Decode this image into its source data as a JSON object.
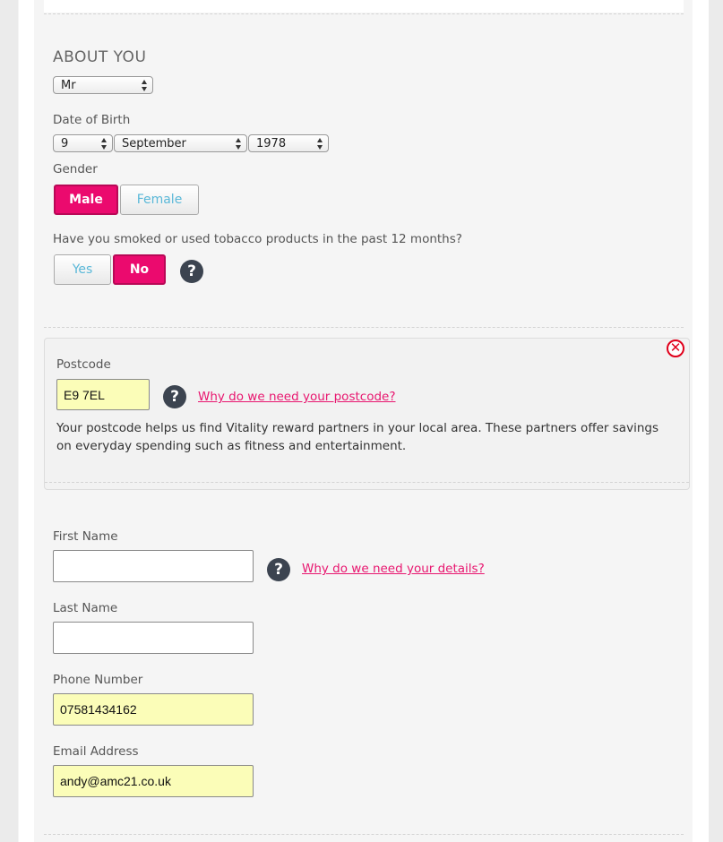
{
  "about": {
    "heading": "ABOUT YOU",
    "title_select": "Mr",
    "dob_label": "Date of Birth",
    "dob_day": "9",
    "dob_month": "September",
    "dob_year": "1978",
    "gender_label": "Gender",
    "gender_male": "Male",
    "gender_female": "Female",
    "gender_selected": "Male",
    "smoke_question": "Have you smoked or used tobacco products in the past 12 months?",
    "smoke_yes": "Yes",
    "smoke_no": "No",
    "smoke_selected": "No"
  },
  "postcode": {
    "label": "Postcode",
    "value": "E9 7EL",
    "help_link": "Why do we need your postcode?",
    "info": "Your postcode helps us find Vitality reward partners in your local area. These partners offer savings on everyday spending such as fitness and entertainment."
  },
  "details": {
    "first_name_label": "First Name",
    "first_name_value": "",
    "help_link": "Why do we need your details?",
    "last_name_label": "Last Name",
    "last_name_value": "",
    "phone_label": "Phone Number",
    "phone_value": "07581434162",
    "email_label": "Email Address",
    "email_value": "andy@amc21.co.uk"
  },
  "icons": {
    "help": "question-mark-icon",
    "close": "close-circle-icon",
    "help_glyph": "?",
    "close_glyph": "✕"
  },
  "colors": {
    "accent": "#eb0a6e",
    "link": "#e8166f",
    "autofill": "#fbfdb8",
    "close": "#e0001b",
    "off_text": "#5ab8d8"
  }
}
